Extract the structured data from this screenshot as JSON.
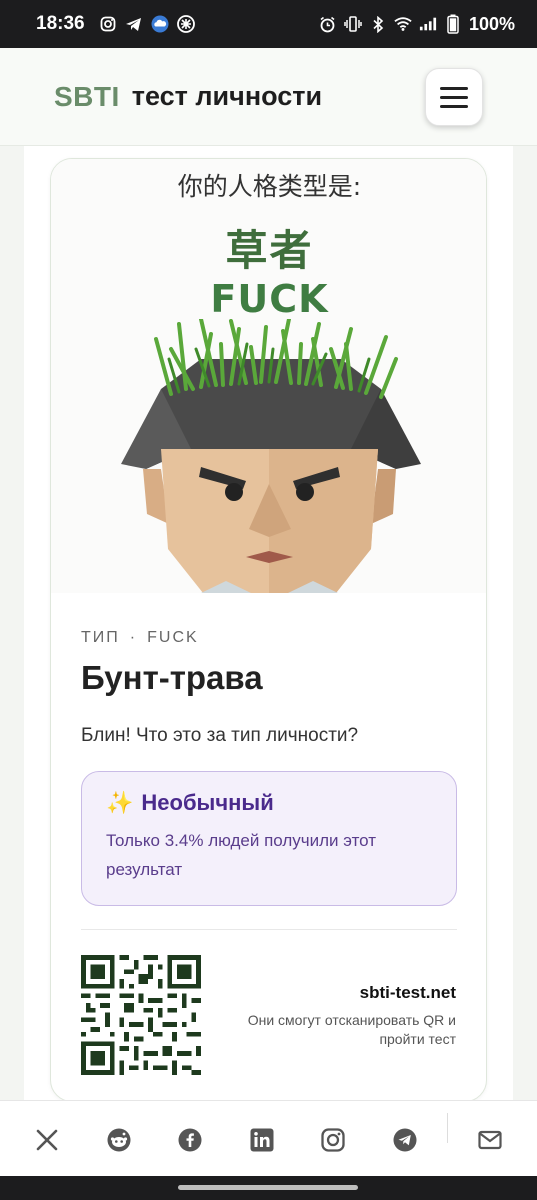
{
  "status_bar": {
    "time": "18:36",
    "battery": "100%",
    "left_icons": [
      "instagram-icon",
      "telegram-icon",
      "cloud-icon",
      "app-icon"
    ],
    "right_icons": [
      "alarm-icon",
      "vibrate-icon",
      "bluetooth-icon",
      "wifi-icon",
      "signal-icon",
      "battery-icon"
    ]
  },
  "header": {
    "brand": "SBTI",
    "title": "тест личности",
    "menu_icon": "hamburger-menu-icon"
  },
  "hero": {
    "caption": "你的人格类型是:",
    "type_cn": "草者",
    "type_en": "FUCK"
  },
  "result": {
    "type_label": "ТИП",
    "separator": "·",
    "type_code": "FUCK",
    "name": "Бунт-трава",
    "tagline": "Блин! Что это за тип личности?",
    "rarity": {
      "icon": "sparkles-icon",
      "title": "Необычный",
      "text": "Только 3.4% людей получили этот результат"
    },
    "site": "sbti-test.net",
    "scan_note": "Они смогут отсканировать QR и пройти тест"
  },
  "share": {
    "icons": [
      "x-icon",
      "reddit-icon",
      "facebook-icon",
      "linkedin-icon",
      "instagram-icon",
      "telegram-icon",
      "mail-icon"
    ]
  },
  "colors": {
    "brand_green": "#6a8c6a",
    "rarity_purple": "#4a2a8c",
    "rarity_bg": "#f4f0fb"
  }
}
